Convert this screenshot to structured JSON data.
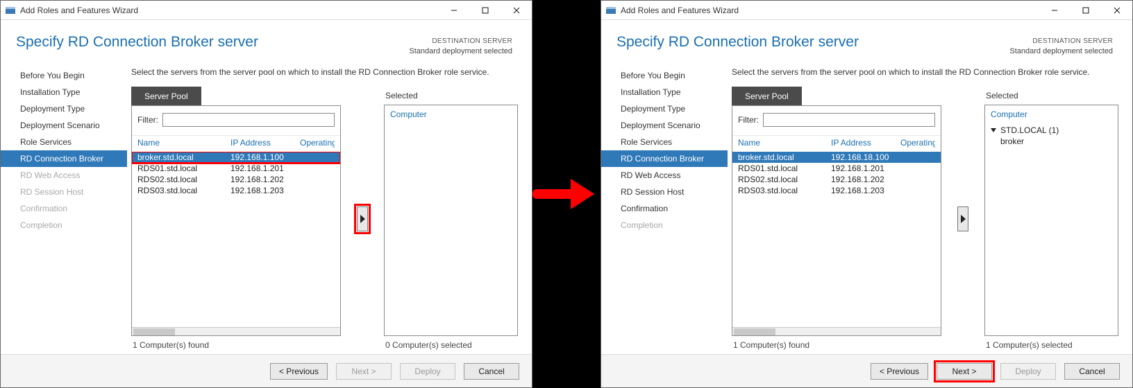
{
  "window": {
    "title": "Add Roles and Features Wizard",
    "page_title": "Specify RD Connection Broker server",
    "dest_hdr": "DESTINATION SERVER",
    "dest_val": "Standard deployment selected"
  },
  "nav": {
    "items": [
      {
        "label": "Before You Begin"
      },
      {
        "label": "Installation Type"
      },
      {
        "label": "Deployment Type"
      },
      {
        "label": "Deployment Scenario"
      },
      {
        "label": "Role Services"
      },
      {
        "label": "RD Connection Broker"
      },
      {
        "label": "RD Web Access"
      },
      {
        "label": "RD Session Host"
      },
      {
        "label": "Confirmation"
      },
      {
        "label": "Completion"
      }
    ]
  },
  "content": {
    "instruction": "Select the servers from the server pool on which to install the RD Connection Broker role service.",
    "tab_pool": "Server Pool",
    "selected_label": "Selected",
    "filter_label": "Filter:",
    "col_name": "Name",
    "col_ip": "IP Address",
    "col_os": "Operating",
    "rows": [
      {
        "name": "broker.std.local",
        "ip_a": "192.168.1.100",
        "ip_b": "192.168.18.100"
      },
      {
        "name": "RDS01.std.local",
        "ip_a": "192.168.1.201",
        "ip_b": "192.168.1.201"
      },
      {
        "name": "RDS02.std.local",
        "ip_a": "192.168.1.202",
        "ip_b": "192.168.1.202"
      },
      {
        "name": "RDS03.std.local",
        "ip_a": "192.168.1.203",
        "ip_b": "192.168.1.203"
      }
    ],
    "found_a": "1 Computer(s) found",
    "found_b": "1 Computer(s) found",
    "sel_header": "Computer",
    "sel_count_a": "0 Computer(s) selected",
    "sel_count_b": "1 Computer(s) selected",
    "sel_tree": {
      "group": "STD.LOCAL (1)",
      "child": "broker"
    }
  },
  "footer": {
    "previous": "< Previous",
    "next": "Next >",
    "deploy": "Deploy",
    "cancel": "Cancel"
  }
}
